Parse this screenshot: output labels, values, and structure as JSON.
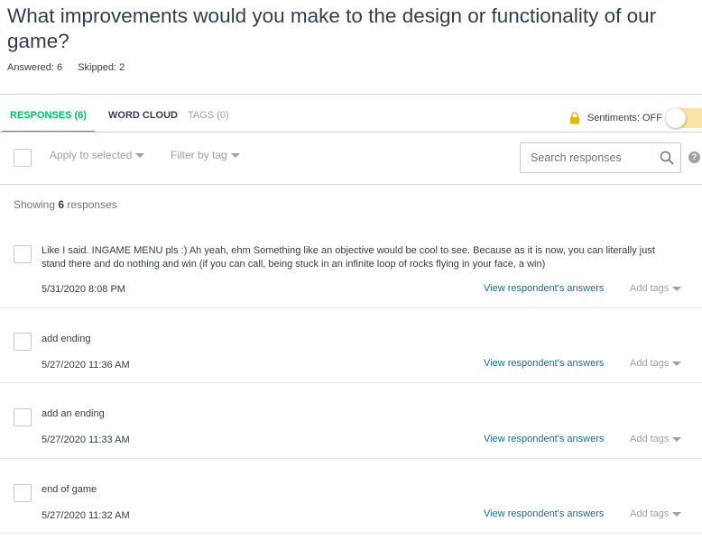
{
  "question": {
    "title": "What improvements would you make to the design or functionality of our game?",
    "answered": "Answered: 6",
    "skipped": "Skipped: 2"
  },
  "tabs": {
    "responses": "RESPONSES (6)",
    "word_cloud": "WORD CLOUD",
    "tags": "TAGS (0)"
  },
  "sentiments": {
    "label": "Sentiments: OFF",
    "enabled": false,
    "icon": "lock-icon"
  },
  "toolbar": {
    "apply_to_selected": "Apply to selected",
    "filter_by_tag": "Filter by tag",
    "search_placeholder": "Search responses",
    "help": "?"
  },
  "showing": {
    "prefix": "Showing",
    "count": "6",
    "suffix": "responses"
  },
  "responses": [
    {
      "text": "Like I said. INGAME MENU pls :) Ah yeah, ehm Something like an objective would be cool to see. Because as it is now, you can literally just stand there and do nothing and win (if you can call, being stuck in an infinite loop of rocks flying in your face, a win)",
      "date": "5/31/2020 8:08 PM",
      "view_link": "View respondent's answers",
      "add_tags": "Add tags"
    },
    {
      "text": "add ending",
      "date": "5/27/2020 11:36 AM",
      "view_link": "View respondent's answers",
      "add_tags": "Add tags"
    },
    {
      "text": "add an ending",
      "date": "5/27/2020 11:33 AM",
      "view_link": "View respondent's answers",
      "add_tags": "Add tags"
    },
    {
      "text": "end of game",
      "date": "5/27/2020 11:32 AM",
      "view_link": "View respondent's answers",
      "add_tags": "Add tags"
    }
  ],
  "colors": {
    "accent": "#00bf6f",
    "link": "#1a6e8f",
    "toggle_track": "#f7e4a6",
    "lock": "#e8b700"
  }
}
